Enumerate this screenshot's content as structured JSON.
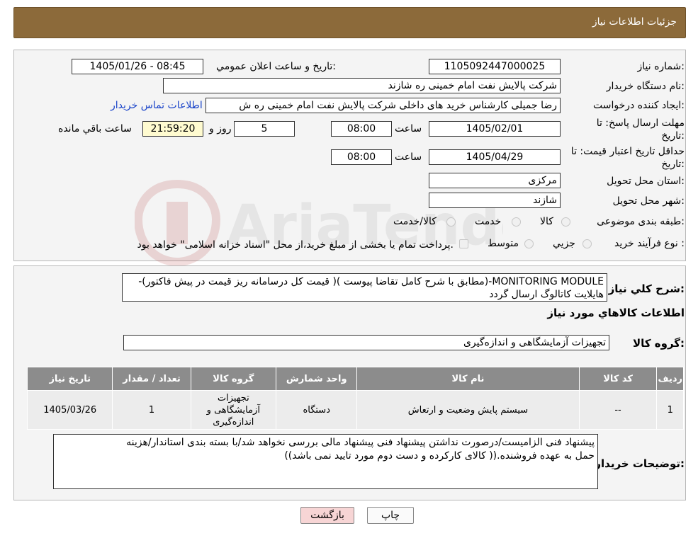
{
  "header": {
    "title": "جزئیات اطلاعات نیاز"
  },
  "form": {
    "need_number_label": "شماره نیاز:",
    "need_number": "1105092447000025",
    "announce_label": "تاریخ و ساعت اعلان عمومي:",
    "announce_value": "1405/01/26 - 08:45",
    "buyer_org_label": "نام دستگاه خريدار:",
    "buyer_org": "شرکت پالایش نفت امام خمینی  ره  شازند",
    "creator_label": "ايجاد کننده درخواست:",
    "creator": "رضا جمیلی کارشناس خرید های داخلی  شرکت پالایش نفت امام خمینی  ره  ش",
    "contact_link": "اطلاعات تماس خریدار",
    "deadline_label_1": "مهلت ارسال پاسخ: تا",
    "deadline_label_2": "تاریخ:",
    "deadline_date": "1405/02/01",
    "time_label": "ساعت",
    "deadline_time": "08:00",
    "days_value": "5",
    "days_label": "روز و",
    "remaining_time": "21:59:20",
    "remaining_label": "ساعت باقي مانده",
    "validity_label_1": "حداقل تاريخ اعتبار قيمت: تا",
    "validity_label_2": "تاريخ:",
    "validity_date": "1405/04/29",
    "validity_time": "08:00",
    "province_label": "استان محل تحويل:",
    "province": "مرکزی",
    "city_label": "شهر محل تحويل:",
    "city": "شازند",
    "category_label": "طبقه بندی موضوعی:",
    "category_options": [
      "کالا",
      "خدمت",
      "کالا/خدمت"
    ],
    "purchase_type_label": "نوع فرآيند خريد :",
    "purchase_options": [
      "جزيي",
      "متوسط"
    ],
    "purchase_note": "پرداخت تمام یا بخشی از مبلغ خرید،از محل \"اسناد خزانه اسلامی\" خواهد بود."
  },
  "details": {
    "summary_label": "شرح كلي نياز:",
    "summary_line1": "MONITORING MODULE-(مطابق با شرح کامل تقاضا پیوست )( قیمت کل درسامانه ریز قیمت در پیش فاکتور)-",
    "summary_line2": "هایلایت کاتالوگ  ارسال گردد",
    "items_title": "اطلاعات کالاهاي مورد نياز",
    "group_label": "گروه کالا:",
    "group_value": "تجهیزات آزمایشگاهی و اندازه‌گیری",
    "table": {
      "headers": [
        "رديف",
        "کد کالا",
        "نام کالا",
        "واحد شمارش",
        "گروه کالا",
        "تعداد / مقدار",
        "تاريخ نياز"
      ],
      "rows": [
        [
          "1",
          "--",
          "سیستم پایش وضعیت و ارتعاش",
          "دستگاه",
          "تجهیزات آزمایشگاهی و اندازه‌گیری",
          "1",
          "1405/03/26"
        ]
      ]
    },
    "buyer_notes_label": "توضيحات خريدار:",
    "buyer_notes_line1": "پیشنهاد فنی الزامیست/درصورت نداشتن پیشنهاد فنی پیشنهاد مالی بررسی نخواهد شد/با بسته بندی استاندار/هزینه",
    "buyer_notes_line2": "حمل به عهده فروشنده.(( کالای کارکرده و دست دوم مورد تایید نمی باشد))"
  },
  "buttons": {
    "print": "چاپ",
    "back": "بازگشت"
  },
  "watermark": {
    "text": "AriaTender.neT"
  },
  "colors": {
    "header": "#8c6a3a",
    "link": "#1a44c9",
    "table_header": "#8c8c8c",
    "back_button": "#f7d5d5"
  }
}
